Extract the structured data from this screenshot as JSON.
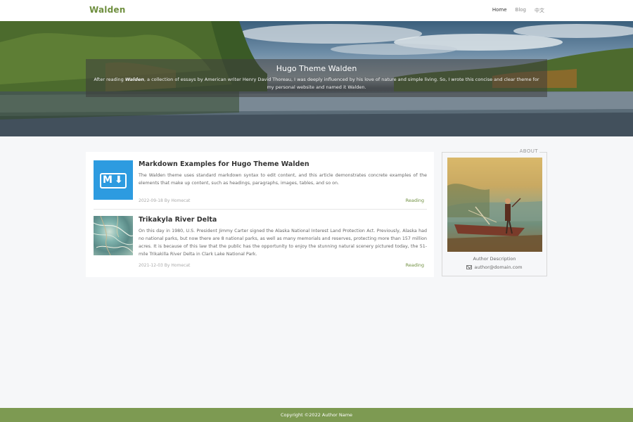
{
  "header": {
    "brand": "Walden",
    "nav": [
      {
        "label": "Home",
        "active": true
      },
      {
        "label": "Blog",
        "active": false
      },
      {
        "label": "中文",
        "active": false
      }
    ]
  },
  "hero": {
    "title": "Hugo Theme Walden",
    "desc_before": "After reading ",
    "desc_book": "Walden",
    "desc_after": ", a collection of essays by American writer Henry David Thoreau, I was deeply influenced by his love of nature and simple living. So, I wrote this concise and clear theme for my personal website and named it Walden."
  },
  "posts": [
    {
      "title": "Markdown Examples for Hugo Theme Walden",
      "excerpt": "The Walden theme uses standard markdown syntax to edit content, and this article demonstrates concrete examples of the elements that make up content, such as headings, paragraphs, images, tables, and so on.",
      "meta": "2022-09-18 By Homecat",
      "read_label": "Reading",
      "thumb_icon": "markdown-icon"
    },
    {
      "title": "Trikakyla River Delta",
      "excerpt": "On this day in 1980, U.S. President Jimmy Carter signed the Alaska National Interest Land Protection Act. Previously, Alaska had no national parks, but now there are 8 national parks, as well as many memorials and reserves, protecting more than 157 million acres. It is because of this law that the public has the opportunity to enjoy the stunning natural scenery pictured today, the 51-mile Trikakilla River Delta in Clark Lake National Park.",
      "meta": "2021-12-03 By Homecat",
      "read_label": "Reading",
      "thumb_icon": "river-delta-image"
    }
  ],
  "about": {
    "label": "ABOUT",
    "description": "Author Description",
    "email": "author@domain.com",
    "email_icon": "mail-icon"
  },
  "footer": {
    "copyright": "Copyright ©2022 Author Name"
  },
  "colors": {
    "accent": "#6f8f3f",
    "footer_bg": "#7d9a52",
    "markdown_blue": "#2d9be0"
  }
}
